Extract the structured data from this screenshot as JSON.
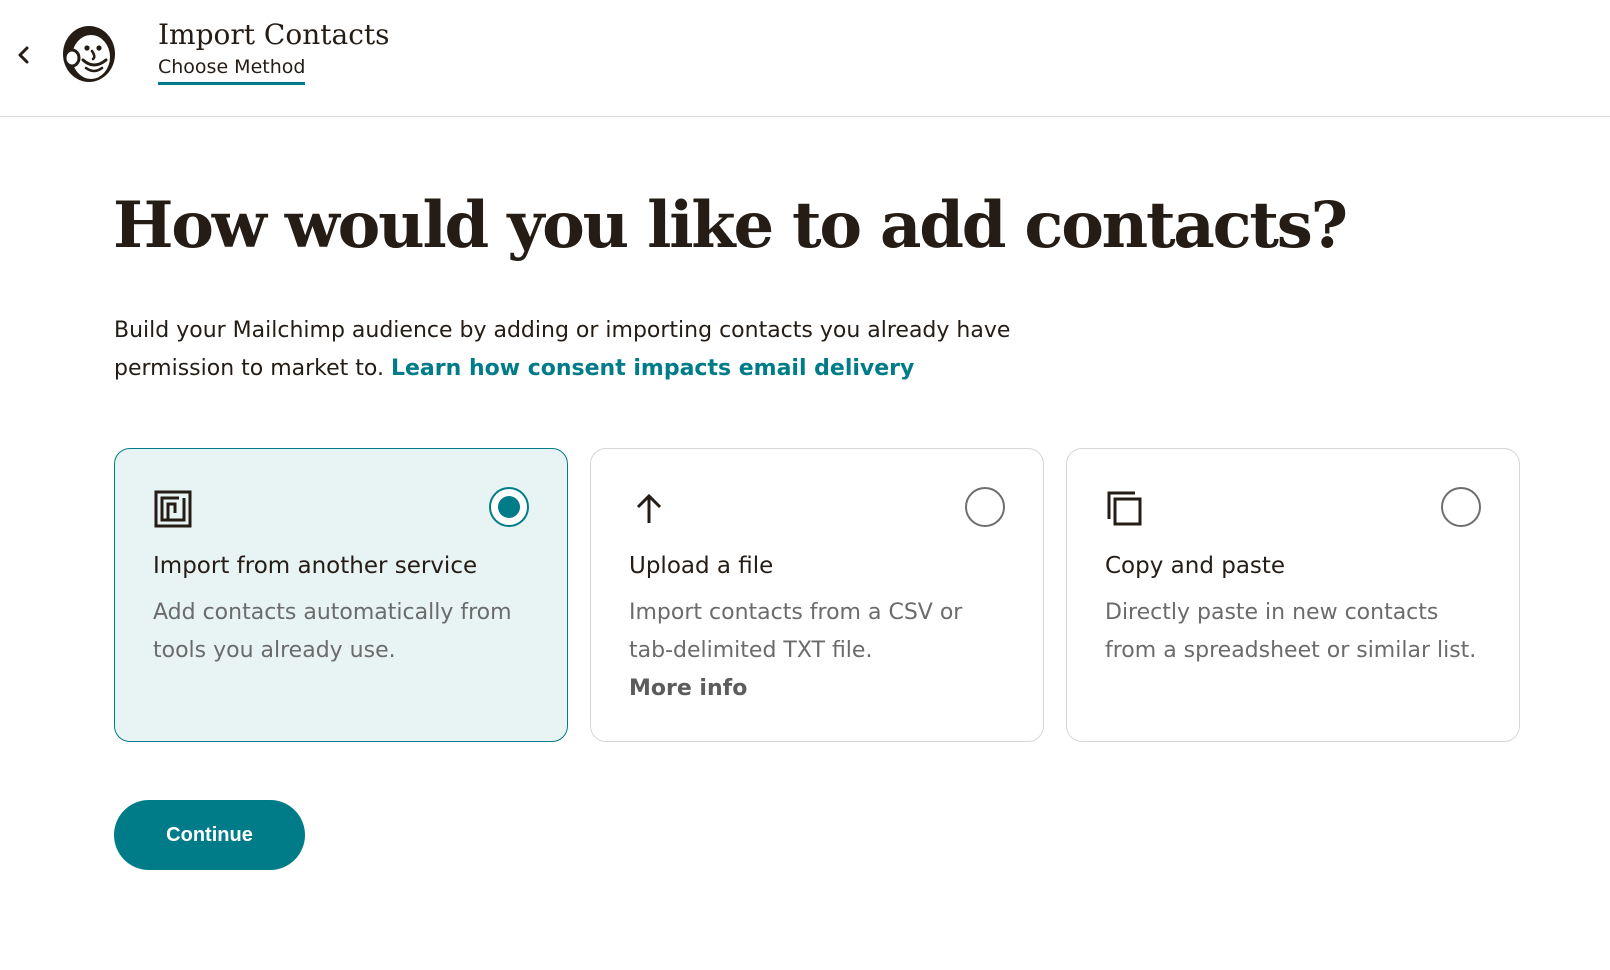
{
  "header": {
    "back_icon": "chevron-left-icon",
    "logo_icon": "mailchimp-freddie-logo",
    "title": "Import Contacts",
    "step": "Choose Method"
  },
  "main": {
    "heading": "How would you like to add contacts?",
    "intro_text": "Build your Mailchimp audience by adding or importing contacts you already have permission to market to.",
    "intro_link": "Learn how consent impacts email delivery"
  },
  "options": [
    {
      "icon": "integration-icon",
      "title": "Import from another service",
      "description": "Add contacts automatically from tools you already use.",
      "selected": true
    },
    {
      "icon": "upload-arrow-icon",
      "title": "Upload a file",
      "description": "Import contacts from a CSV or tab-delimited TXT file.",
      "more": "More info",
      "selected": false
    },
    {
      "icon": "copy-icon",
      "title": "Copy and paste",
      "description": "Directly paste in new contacts from a spreadsheet or similar list.",
      "selected": false
    }
  ],
  "actions": {
    "continue_label": "Continue"
  },
  "colors": {
    "accent": "#007c89",
    "selected_bg": "#e8f3f3",
    "text": "#241c15"
  }
}
